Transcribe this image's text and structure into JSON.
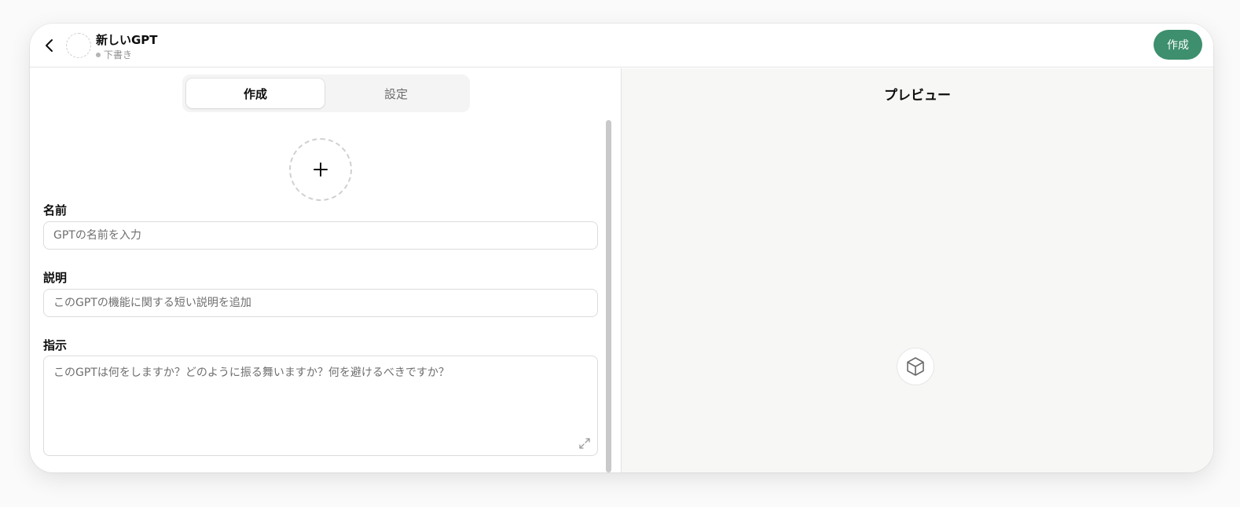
{
  "header": {
    "title": "新しいGPT",
    "status": "下書き",
    "create_label": "作成"
  },
  "tabs": [
    {
      "label": "作成",
      "active": true
    },
    {
      "label": "設定",
      "active": false
    }
  ],
  "form": {
    "name": {
      "label": "名前",
      "placeholder": "GPTの名前を入力",
      "value": ""
    },
    "description": {
      "label": "説明",
      "placeholder": "このGPTの機能に関する短い説明を追加",
      "value": ""
    },
    "instructions": {
      "label": "指示",
      "placeholder": "このGPTは何をしますか？どのように振る舞いますか？何を避けるべきですか？",
      "value": ""
    }
  },
  "preview": {
    "title": "プレビュー"
  },
  "icons": {
    "back": "chevron-left-icon",
    "upload": "plus-icon",
    "expand": "expand-icon",
    "preview": "cube-icon"
  },
  "colors": {
    "accent": "#3d8f6e",
    "preview_bg": "#f7f7f6"
  }
}
